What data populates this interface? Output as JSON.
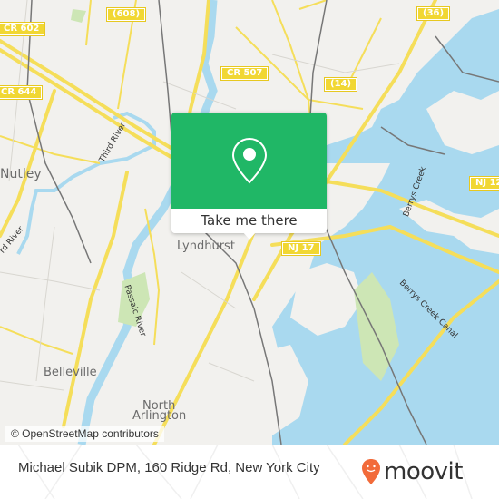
{
  "map": {
    "places": [
      {
        "id": "nutley",
        "label": "Nutley"
      },
      {
        "id": "lyndhurst",
        "label": "Lyndhurst"
      },
      {
        "id": "belleville",
        "label": "Belleville"
      },
      {
        "id": "north-arlington-1",
        "label": "North"
      },
      {
        "id": "north-arlington-2",
        "label": "Arlington"
      }
    ],
    "route_shields": [
      {
        "id": "cr602",
        "label": "CR 602"
      },
      {
        "id": "608",
        "label": "(608)"
      },
      {
        "id": "cr507",
        "label": "CR 507"
      },
      {
        "id": "cr644",
        "label": "CR 644"
      },
      {
        "id": "14",
        "label": "(14)"
      },
      {
        "id": "36",
        "label": "(36)"
      },
      {
        "id": "nj17",
        "label": "NJ 17"
      },
      {
        "id": "nj120",
        "label": "NJ 12"
      }
    ],
    "water_labels": [
      {
        "id": "third-river",
        "label": "Third River"
      },
      {
        "id": "third-river-2",
        "label": "rd River"
      },
      {
        "id": "passaic-river",
        "label": "Passaic River"
      },
      {
        "id": "berrys-creek",
        "label": "Berrys Creek"
      },
      {
        "id": "berrys-creek-canal",
        "label": "Berrys Creek Canal"
      }
    ],
    "attribution": "© OpenStreetMap contributors",
    "colors": {
      "land": "#f2f1ee",
      "water": "#a9d9ef",
      "road": "#f5de5a",
      "park": "#cde6b5",
      "rail": "#777777"
    }
  },
  "popup": {
    "action_label": "Take me there",
    "icon": "map-pin-icon",
    "color": "#20b766"
  },
  "footer": {
    "title": "Michael Subik DPM, 160 Ridge Rd, New York City",
    "logo_text": "moovit",
    "logo_color": "#f26b3a"
  }
}
